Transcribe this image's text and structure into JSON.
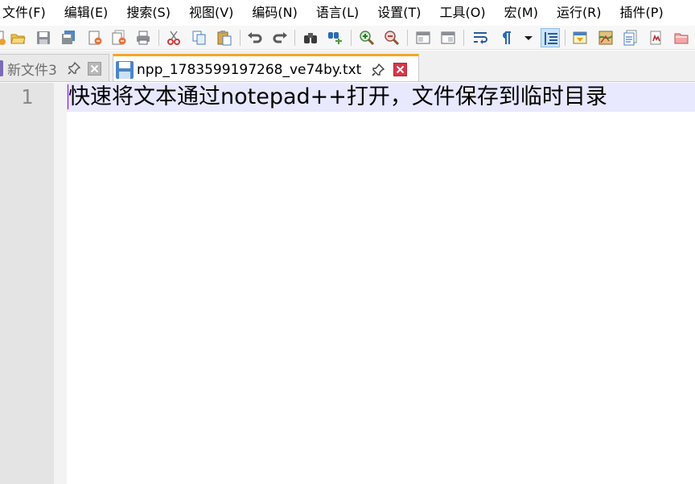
{
  "menubar": {
    "items": [
      {
        "label": "文件(F)"
      },
      {
        "label": "编辑(E)"
      },
      {
        "label": "搜索(S)"
      },
      {
        "label": "视图(V)"
      },
      {
        "label": "编码(N)"
      },
      {
        "label": "语言(L)"
      },
      {
        "label": "设置(T)"
      },
      {
        "label": "工具(O)"
      },
      {
        "label": "宏(M)"
      },
      {
        "label": "运行(R)"
      },
      {
        "label": "插件(P)"
      }
    ]
  },
  "toolbar": {
    "buttons": [
      {
        "icon": "new-file-icon"
      },
      {
        "icon": "open-folder-icon"
      },
      {
        "icon": "save-icon"
      },
      {
        "icon": "save-all-icon"
      },
      {
        "icon": "close-file-icon"
      },
      {
        "icon": "close-all-icon"
      },
      {
        "icon": "print-icon"
      },
      {
        "icon": "cut-icon"
      },
      {
        "icon": "copy-icon"
      },
      {
        "icon": "paste-icon"
      },
      {
        "icon": "undo-icon"
      },
      {
        "icon": "redo-icon"
      },
      {
        "icon": "find-icon"
      },
      {
        "icon": "replace-icon"
      },
      {
        "icon": "zoom-in-icon"
      },
      {
        "icon": "zoom-out-icon"
      },
      {
        "icon": "sync-vertical-icon"
      },
      {
        "icon": "sync-horizontal-icon"
      },
      {
        "icon": "word-wrap-icon"
      },
      {
        "icon": "show-all-characters-icon"
      },
      {
        "icon": "dropdown-arrow-icon"
      },
      {
        "icon": "indent-guide-icon",
        "pressed": true
      },
      {
        "icon": "user-defined-language-icon"
      },
      {
        "icon": "document-map-icon"
      },
      {
        "icon": "function-list-icon"
      },
      {
        "icon": "folder-as-workspace-icon"
      },
      {
        "icon": "monitoring-icon"
      }
    ]
  },
  "tabs": [
    {
      "label": "新文件3",
      "icon": "document-icon",
      "active": false
    },
    {
      "label": "npp_1783599197268_ve74by.txt",
      "icon": "save-icon",
      "active": true
    }
  ],
  "editor": {
    "line_number": "1",
    "lines": [
      "快速将文本通过notepad++打开，文件保存到临时目录"
    ]
  },
  "colors": {
    "tab_accent": "#f5a623",
    "current_line": "#e8e8ff",
    "caret": "#8000ff",
    "gutter": "#e4e4e4",
    "tab_close_red": "#d9364a"
  }
}
